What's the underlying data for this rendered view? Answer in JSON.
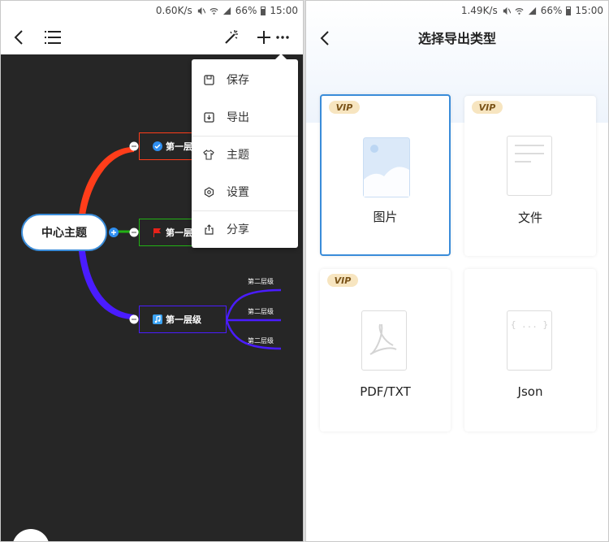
{
  "left_screen": {
    "status": {
      "speed": "0.60K/s",
      "battery": "66%",
      "time": "15:00"
    },
    "menu": {
      "items": [
        {
          "label": "保存",
          "icon": "save-icon"
        },
        {
          "label": "导出",
          "icon": "export-icon"
        },
        {
          "label": "主题",
          "icon": "theme-shirt-icon"
        },
        {
          "label": "设置",
          "icon": "settings-icon"
        },
        {
          "label": "分享",
          "icon": "share-icon"
        }
      ]
    },
    "mindmap": {
      "center": "中心主题",
      "branches": [
        {
          "label": "第一层",
          "color": "#ff3d1a",
          "icon": "check-circle-icon"
        },
        {
          "label": "第一层",
          "color": "#22b214",
          "icon": "red-flag-icon"
        },
        {
          "label": "第一层级",
          "color": "#4a1cff",
          "icon": "music-note-icon",
          "children": [
            "第二层级",
            "第二层级",
            "第二层级"
          ]
        }
      ]
    }
  },
  "right_screen": {
    "status": {
      "speed": "1.49K/s",
      "battery": "66%",
      "time": "15:00"
    },
    "title": "选择导出类型",
    "cards": [
      {
        "label": "图片",
        "vip": "VIP",
        "icon": "image-file-icon",
        "selected": true
      },
      {
        "label": "文件",
        "vip": "VIP",
        "icon": "document-file-icon",
        "selected": false
      },
      {
        "label": "PDF/TXT",
        "vip": "VIP",
        "icon": "pdf-file-icon",
        "selected": false
      },
      {
        "label": "Json",
        "icon": "json-file-icon",
        "json_glyph": "{ ... }",
        "selected": false
      }
    ]
  },
  "colors": {
    "accent": "#3a8cd9",
    "canvas": "#262626",
    "vip_bg": "#f7e5c0",
    "vip_text": "#7a5318"
  }
}
